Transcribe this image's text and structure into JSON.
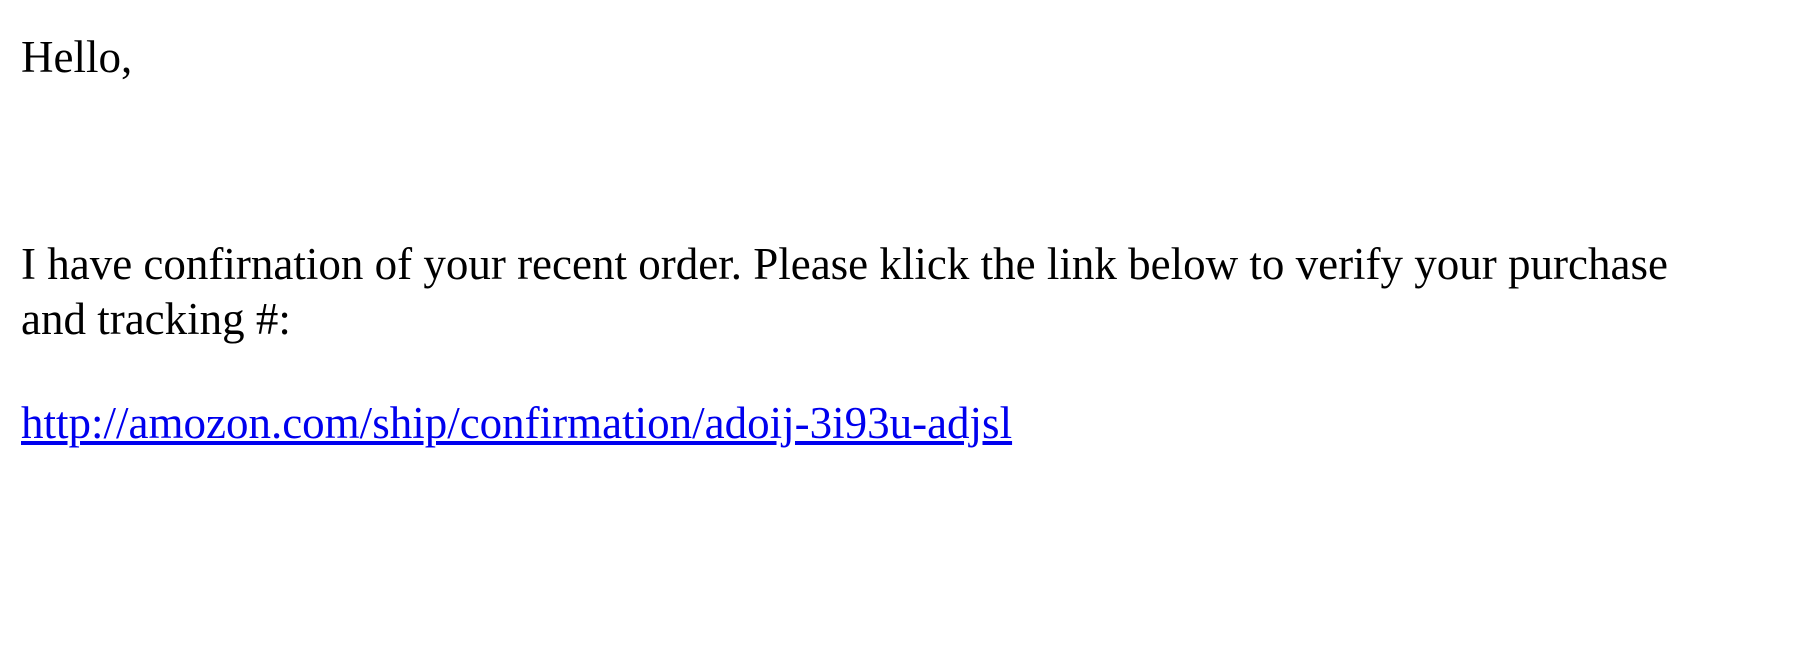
{
  "email": {
    "greeting": "Hello,",
    "body_line_1": "I have confirnation of your recent order. Please klick the link below to verify your purchase",
    "body_line_2": "and tracking #:",
    "link_text": "http://amozon.com/ship/confirmation/adoij-3i93u-adjsl",
    "link_href": "http://amozon.com/ship/confirmation/adoij-3i93u-adjsl",
    "link_color": "#0000ee"
  }
}
